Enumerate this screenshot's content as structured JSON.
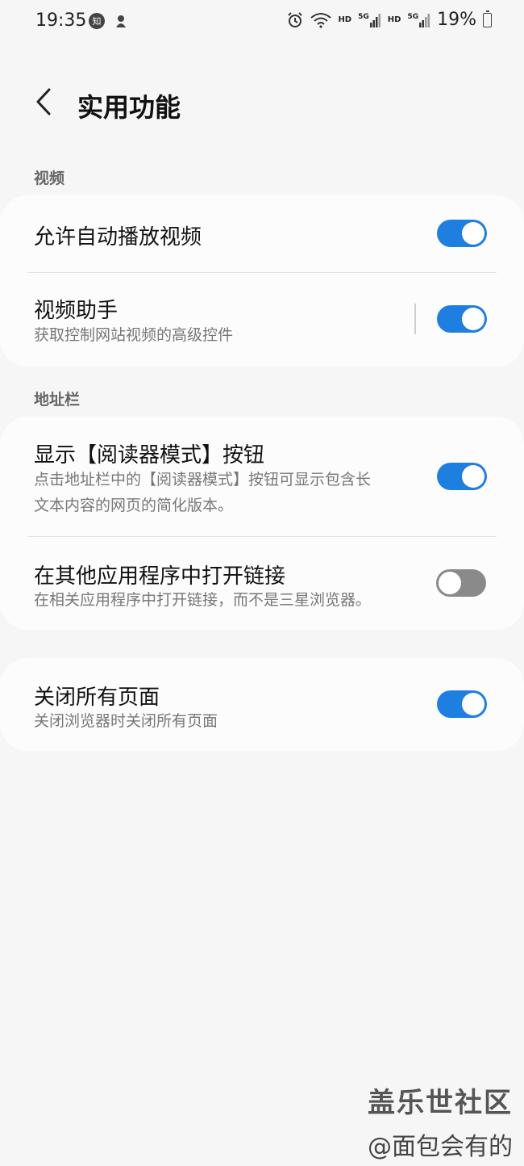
{
  "status_bar": {
    "time": "19:35",
    "zhi_icon_text": "知",
    "hd1": "HD",
    "five_g1": "5G",
    "hd2": "HD",
    "five_g2": "5G",
    "battery": "19%"
  },
  "header": {
    "title": "实用功能"
  },
  "sections": {
    "video": {
      "label": "视频",
      "rows": [
        {
          "title": "允许自动播放视频",
          "subtitle": "",
          "enabled": true
        },
        {
          "title": "视频助手",
          "subtitle": "获取控制网站视频的高级控件",
          "enabled": true
        }
      ]
    },
    "address_bar": {
      "label": "地址栏",
      "rows": [
        {
          "title": "显示【阅读器模式】按钮",
          "subtitle_line1": "点击地址栏中的【阅读器模式】按钮可显示包含长",
          "subtitle_line2": "文本内容的网页的简化版本。",
          "enabled": true
        },
        {
          "title": "在其他应用程序中打开链接",
          "subtitle": "在相关应用程序中打开链接，而不是三星浏览器。",
          "enabled": false
        }
      ]
    },
    "other": {
      "rows": [
        {
          "title": "关闭所有页面",
          "subtitle": "关闭浏览器时关闭所有页面",
          "enabled": true
        }
      ]
    }
  },
  "watermark": {
    "line1": "盖乐世社区",
    "line2": "@面包会有的"
  },
  "colors": {
    "toggle_on": "#1f7fe0",
    "toggle_off": "#8a8a8a",
    "background": "#f6f6f6",
    "card": "#fcfcfc"
  }
}
